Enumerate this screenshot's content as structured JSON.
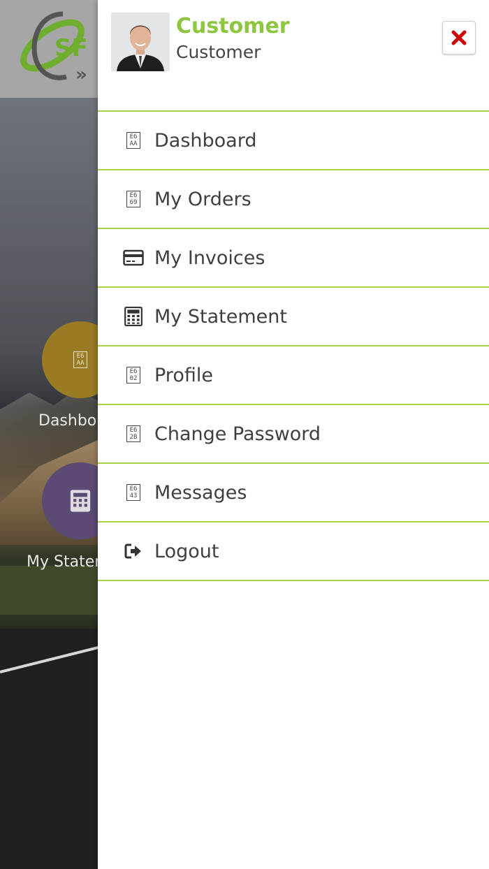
{
  "user": {
    "name": "Customer",
    "role": "Customer"
  },
  "background": {
    "tiles": [
      {
        "label": "Dashbo"
      },
      {
        "label": "My Stater"
      }
    ]
  },
  "menu": {
    "items": [
      {
        "label": "Dashboard",
        "icon": "missing-glyph-icon"
      },
      {
        "label": "My Orders",
        "icon": "missing-glyph-icon"
      },
      {
        "label": "My Invoices",
        "icon": "credit-card-icon"
      },
      {
        "label": "My Statement",
        "icon": "calculator-icon"
      },
      {
        "label": "Profile",
        "icon": "missing-glyph-icon"
      },
      {
        "label": "Change Password",
        "icon": "missing-glyph-icon"
      },
      {
        "label": "Messages",
        "icon": "missing-glyph-icon"
      },
      {
        "label": "Logout",
        "icon": "sign-out-icon"
      }
    ]
  },
  "colors": {
    "accent": "#8dc63f",
    "divider": "#a8cf45",
    "close": "#cc0000"
  }
}
